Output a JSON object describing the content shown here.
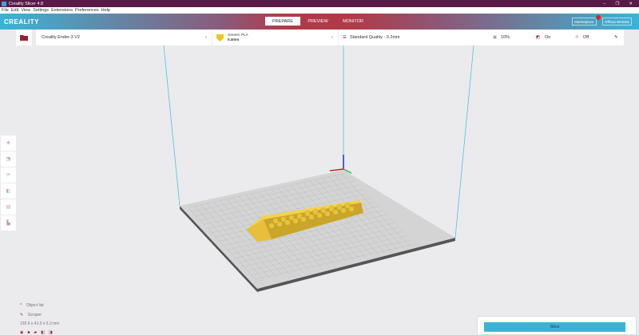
{
  "window": {
    "title": "Creality Slicer 4.8",
    "controls": [
      "–",
      "❐",
      "✕"
    ]
  },
  "menu": [
    "File",
    "Edit",
    "View",
    "Settings",
    "Extensions",
    "Preferences",
    "Help"
  ],
  "header": {
    "logo": "CREALITY",
    "tabs": [
      "PREPARE",
      "PREVIEW",
      "MONITOR"
    ],
    "active_tab": "PREPARE",
    "marketplace": "Marketplace",
    "official_website": "Official Website",
    "marketplace_badge": "1"
  },
  "printer": {
    "name": "Creality Ender-3 V2"
  },
  "material": {
    "name": "Generic PLA",
    "nozzle": "0.4mm"
  },
  "profile": {
    "name": "Standard Quality - 0.2mm",
    "infill": "10%",
    "support": "On",
    "adhesion": "Off"
  },
  "objects": {
    "header": "Object list",
    "name": "Scraper",
    "dimensions": "135.6 x 41.0 x 6.3 mm"
  },
  "slice": {
    "label": "Slice"
  },
  "colors": {
    "accent": "#3ab4d6",
    "brand": "#b23a48",
    "object": "#f5d24a"
  }
}
